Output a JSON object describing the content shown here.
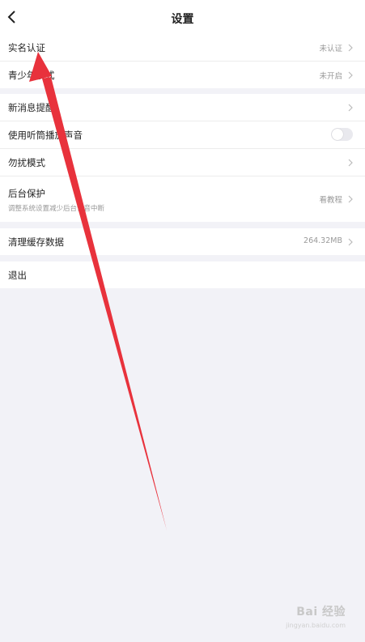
{
  "header": {
    "title": "设置",
    "back_icon": "chevron-left-icon"
  },
  "section1": {
    "items": [
      {
        "label": "实名认证",
        "value": "未认证"
      },
      {
        "label": "青少年模式",
        "value": "未开启"
      }
    ]
  },
  "section2": {
    "items": [
      {
        "label": "新消息提醒"
      },
      {
        "label": "使用听筒播放声音",
        "toggle": false
      },
      {
        "label": "勿扰模式"
      },
      {
        "label": "后台保护",
        "sublabel": "调整系统设置减少后台语音中断",
        "value": "看教程"
      }
    ]
  },
  "section3": {
    "items": [
      {
        "label": "清理缓存数据",
        "value": "264.32MB"
      }
    ]
  },
  "section4": {
    "items": [
      {
        "label": "退出"
      }
    ]
  },
  "watermark": {
    "text": "Bai 经验",
    "url": "jingyan.baidu.com"
  },
  "colors": {
    "background": "#f2f2f7",
    "annotation_arrow": "#e8323c",
    "secondary_text": "#999999"
  }
}
